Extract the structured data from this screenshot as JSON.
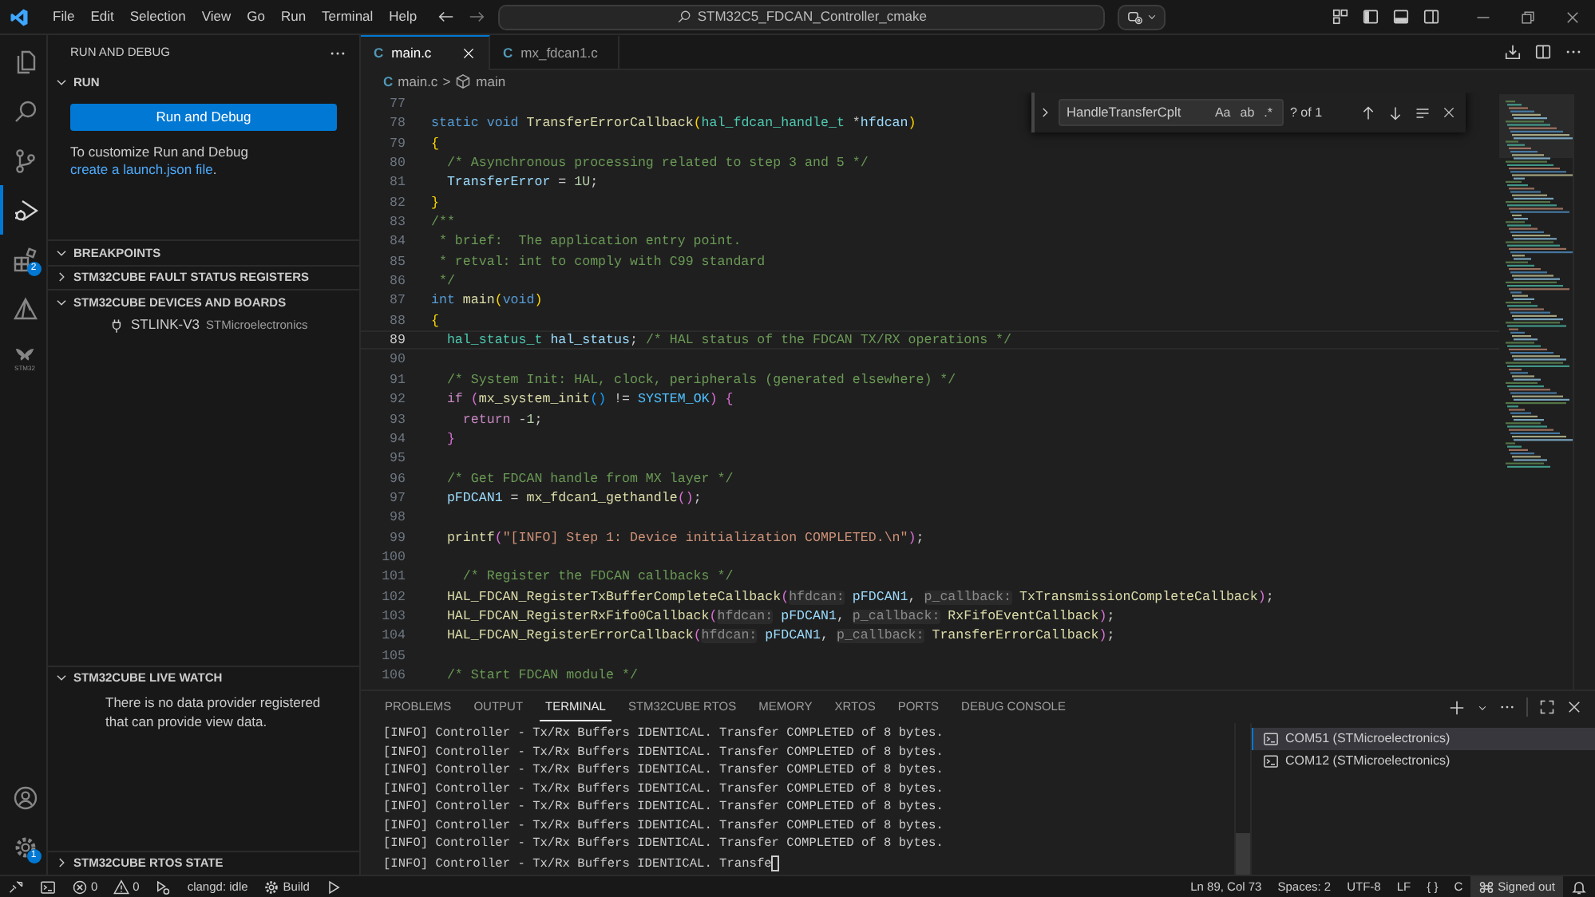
{
  "title_bar": {
    "menu": [
      "File",
      "Edit",
      "Selection",
      "View",
      "Go",
      "Run",
      "Terminal",
      "Help"
    ],
    "command_center": "STM32C5_FDCAN_Controller_cmake"
  },
  "activity_bar": {
    "items": [
      {
        "kind": "files",
        "selected": false
      },
      {
        "kind": "search",
        "selected": false
      },
      {
        "kind": "scm",
        "selected": false
      },
      {
        "kind": "debug",
        "selected": true
      },
      {
        "kind": "extensions",
        "selected": false,
        "badge": "2"
      },
      {
        "kind": "cube",
        "selected": false
      },
      {
        "kind": "stm32",
        "selected": false,
        "label": "STM32"
      }
    ],
    "bottom": [
      {
        "kind": "account"
      },
      {
        "kind": "settings",
        "badge": "1"
      }
    ]
  },
  "sidebar": {
    "title": "RUN AND DEBUG",
    "sections": [
      {
        "title": "RUN",
        "expanded": true,
        "kind": "run",
        "button": "Run and Debug",
        "text": "To customize Run and Debug ",
        "link": "create a launch.json file",
        "text_end": "."
      },
      {
        "title": "BREAKPOINTS",
        "expanded": true
      },
      {
        "title": "STM32CUBE FAULT STATUS REGISTERS",
        "expanded": false
      },
      {
        "title": "STM32CUBE DEVICES AND BOARDS",
        "expanded": true,
        "kind": "devices",
        "items": [
          {
            "name": "STLINK-V3",
            "detail": "STMicroelectronics"
          }
        ]
      },
      {
        "title": "STM32CUBE LIVE WATCH",
        "expanded": true,
        "kind": "message",
        "text": "There is no data provider registered that can provide view data."
      },
      {
        "title": "STM32CUBE RTOS STATE",
        "expanded": false
      }
    ]
  },
  "editor": {
    "tabs": [
      {
        "icon": "C",
        "label": "main.c",
        "selected": true
      },
      {
        "icon": "C",
        "label": "mx_fdcan1.c",
        "selected": false
      }
    ],
    "breadcrumbs": {
      "file_icon": "C",
      "file": "main.c",
      "separator": ">",
      "symbol": "main"
    },
    "find": {
      "value": "HandleTransferCplt",
      "options": [
        {
          "label": "Aa",
          "selected": false
        },
        {
          "label": "ab",
          "selected": false
        },
        {
          "label": ".*",
          "selected": false
        }
      ],
      "result": "? of 1"
    },
    "lines": [
      {
        "number": "77",
        "current": false
      },
      {
        "number": "78",
        "current": false,
        "tokens": [
          {
            "kind": "kw",
            "text": "static void "
          },
          {
            "kind": "fn",
            "text": "TransferErrorCallback"
          },
          {
            "kind": "br1",
            "text": "("
          },
          {
            "kind": "type",
            "text": "hal_fdcan_handle_t"
          },
          {
            "kind": "p",
            "text": " *"
          },
          {
            "kind": "var",
            "text": "hfdcan"
          },
          {
            "kind": "br1",
            "text": ")"
          }
        ]
      },
      {
        "number": "79",
        "current": false,
        "tokens": [
          {
            "kind": "br1",
            "text": "{"
          }
        ]
      },
      {
        "number": "80",
        "current": false,
        "tokens": [
          {
            "kind": "cm",
            "text": "  /* Asynchronous processing related to step 3 and 5 */"
          }
        ]
      },
      {
        "number": "81",
        "current": false,
        "tokens": [
          {
            "kind": "var",
            "text": "  TransferError"
          },
          {
            "kind": "p",
            "text": " = "
          },
          {
            "kind": "num",
            "text": "1U"
          },
          {
            "kind": "p",
            "text": ";"
          }
        ]
      },
      {
        "number": "82",
        "current": false,
        "tokens": [
          {
            "kind": "br1",
            "text": "}"
          }
        ]
      },
      {
        "number": "83",
        "current": false,
        "tokens": [
          {
            "kind": "cm",
            "text": "/**"
          }
        ]
      },
      {
        "number": "84",
        "current": false,
        "tokens": [
          {
            "kind": "cm",
            "text": " * brief:  The application entry point."
          }
        ]
      },
      {
        "number": "85",
        "current": false,
        "tokens": [
          {
            "kind": "cm",
            "text": " * retval: int to comply with C99 standard"
          }
        ]
      },
      {
        "number": "86",
        "current": false,
        "tokens": [
          {
            "kind": "cm",
            "text": " */"
          }
        ]
      },
      {
        "number": "87",
        "current": false,
        "tokens": [
          {
            "kind": "kw",
            "text": "int "
          },
          {
            "kind": "fn",
            "text": "main"
          },
          {
            "kind": "br1",
            "text": "("
          },
          {
            "kind": "kw",
            "text": "void"
          },
          {
            "kind": "br1",
            "text": ")"
          }
        ]
      },
      {
        "number": "88",
        "current": false,
        "tokens": [
          {
            "kind": "br1",
            "text": "{"
          }
        ]
      },
      {
        "number": "89",
        "current": true,
        "tokens": [
          {
            "kind": "type",
            "text": "  hal_status_t "
          },
          {
            "kind": "var",
            "text": "hal_status"
          },
          {
            "kind": "p",
            "text": "; "
          },
          {
            "kind": "cm",
            "text": "/* HAL status of the FDCAN TX/RX operations */"
          }
        ]
      },
      {
        "number": "90",
        "current": false
      },
      {
        "number": "91",
        "current": false,
        "tokens": [
          {
            "kind": "cm",
            "text": "  /* System Init: HAL, clock, peripherals (generated elsewhere) */"
          }
        ]
      },
      {
        "number": "92",
        "current": false,
        "tokens": [
          {
            "kind": "ctl",
            "text": "  if "
          },
          {
            "kind": "br2",
            "text": "("
          },
          {
            "kind": "fn",
            "text": "mx_system_init"
          },
          {
            "kind": "br3",
            "text": "()"
          },
          {
            "kind": "p",
            "text": " != "
          },
          {
            "kind": "macro",
            "text": "SYSTEM_OK"
          },
          {
            "kind": "br2",
            "text": ") {"
          }
        ]
      },
      {
        "number": "93",
        "current": false,
        "tokens": [
          {
            "kind": "ctl",
            "text": "    return"
          },
          {
            "kind": "p",
            "text": " -"
          },
          {
            "kind": "num",
            "text": "1"
          },
          {
            "kind": "p",
            "text": ";"
          }
        ]
      },
      {
        "number": "94",
        "current": false,
        "tokens": [
          {
            "kind": "br2",
            "text": "  }"
          }
        ]
      },
      {
        "number": "95",
        "current": false
      },
      {
        "number": "96",
        "current": false,
        "tokens": [
          {
            "kind": "cm",
            "text": "  /* Get FDCAN handle from MX layer */"
          }
        ]
      },
      {
        "number": "97",
        "current": false,
        "tokens": [
          {
            "kind": "var",
            "text": "  pFDCAN1"
          },
          {
            "kind": "p",
            "text": " = "
          },
          {
            "kind": "fn",
            "text": "mx_fdcan1_gethandle"
          },
          {
            "kind": "br2",
            "text": "()"
          },
          {
            "kind": "p",
            "text": ";"
          }
        ]
      },
      {
        "number": "98",
        "current": false
      },
      {
        "number": "99",
        "current": false,
        "tokens": [
          {
            "kind": "fn",
            "text": "  printf"
          },
          {
            "kind": "br2",
            "text": "("
          },
          {
            "kind": "str",
            "text": "\"[INFO] Step 1: Device initialization COMPLETED.\\n\""
          },
          {
            "kind": "br2",
            "text": ")"
          },
          {
            "kind": "p",
            "text": ";"
          }
        ]
      },
      {
        "number": "100",
        "current": false
      },
      {
        "number": "101",
        "current": false,
        "tokens": [
          {
            "kind": "cm",
            "text": "    /* Register the FDCAN callbacks */"
          }
        ]
      },
      {
        "number": "102",
        "current": false,
        "tokens": [
          {
            "kind": "fn",
            "text": "  HAL_FDCAN_RegisterTxBufferCompleteCallback"
          },
          {
            "kind": "br2",
            "text": "("
          },
          {
            "kind": "hint",
            "text": "hfdcan:"
          },
          {
            "kind": "var",
            "text": " pFDCAN1"
          },
          {
            "kind": "p",
            "text": ", "
          },
          {
            "kind": "hint",
            "text": "p_callback:"
          },
          {
            "kind": "fn",
            "text": " TxTransmissionCompleteCallback"
          },
          {
            "kind": "br2",
            "text": ")"
          },
          {
            "kind": "p",
            "text": ";"
          }
        ]
      },
      {
        "number": "103",
        "current": false,
        "tokens": [
          {
            "kind": "fn",
            "text": "  HAL_FDCAN_RegisterRxFifo0Callback"
          },
          {
            "kind": "br2",
            "text": "("
          },
          {
            "kind": "hint",
            "text": "hfdcan:"
          },
          {
            "kind": "var",
            "text": " pFDCAN1"
          },
          {
            "kind": "p",
            "text": ", "
          },
          {
            "kind": "hint",
            "text": "p_callback:"
          },
          {
            "kind": "fn",
            "text": " RxFifoEventCallback"
          },
          {
            "kind": "br2",
            "text": ")"
          },
          {
            "kind": "p",
            "text": ";"
          }
        ]
      },
      {
        "number": "104",
        "current": false,
        "tokens": [
          {
            "kind": "fn",
            "text": "  HAL_FDCAN_RegisterErrorCallback"
          },
          {
            "kind": "br2",
            "text": "("
          },
          {
            "kind": "hint",
            "text": "hfdcan:"
          },
          {
            "kind": "var",
            "text": " pFDCAN1"
          },
          {
            "kind": "p",
            "text": ", "
          },
          {
            "kind": "hint",
            "text": "p_callback:"
          },
          {
            "kind": "fn",
            "text": " TransferErrorCallback"
          },
          {
            "kind": "br2",
            "text": ")"
          },
          {
            "kind": "p",
            "text": ";"
          }
        ]
      },
      {
        "number": "105",
        "current": false
      },
      {
        "number": "106",
        "current": false,
        "tokens": [
          {
            "kind": "cm",
            "text": "  /* Start FDCAN module */"
          }
        ]
      }
    ]
  },
  "panel": {
    "tabs": [
      {
        "label": "PROBLEMS",
        "selected": false
      },
      {
        "label": "OUTPUT",
        "selected": false
      },
      {
        "label": "TERMINAL",
        "selected": true
      },
      {
        "label": "STM32CUBE RTOS",
        "selected": false
      },
      {
        "label": "MEMORY",
        "selected": false
      },
      {
        "label": "XRTOS",
        "selected": false
      },
      {
        "label": "PORTS",
        "selected": false
      },
      {
        "label": "DEBUG CONSOLE",
        "selected": false
      }
    ],
    "terminal_lines": [
      "[INFO] Controller - Tx/Rx Buffers IDENTICAL. Transfer COMPLETED of 8 bytes.",
      "[INFO] Controller - Tx/Rx Buffers IDENTICAL. Transfer COMPLETED of 8 bytes.",
      "[INFO] Controller - Tx/Rx Buffers IDENTICAL. Transfer COMPLETED of 8 bytes.",
      "[INFO] Controller - Tx/Rx Buffers IDENTICAL. Transfer COMPLETED of 8 bytes.",
      "[INFO] Controller - Tx/Rx Buffers IDENTICAL. Transfer COMPLETED of 8 bytes.",
      "[INFO] Controller - Tx/Rx Buffers IDENTICAL. Transfer COMPLETED of 8 bytes.",
      "[INFO] Controller - Tx/Rx Buffers IDENTICAL. Transfer COMPLETED of 8 bytes.",
      "[INFO] Controller - Tx/Rx Buffers IDENTICAL. Transfe"
    ],
    "cursor": true,
    "terminals": [
      {
        "label": "COM51 (STMicroelectronics)",
        "selected": true
      },
      {
        "label": "COM12 (STMicroelectronics)",
        "selected": false
      }
    ]
  },
  "status_bar": {
    "left": [
      {
        "kind": "remote"
      },
      {
        "kind": "terminal"
      },
      {
        "kind": "errors",
        "text": "0"
      },
      {
        "kind": "warnings",
        "text": "0"
      },
      {
        "kind": "debug"
      },
      {
        "kind": "text",
        "text": "clangd: idle"
      },
      {
        "kind": "build",
        "text": "Build"
      },
      {
        "kind": "run"
      }
    ],
    "right": [
      {
        "kind": "text",
        "text": "Ln 89, Col 73"
      },
      {
        "kind": "text",
        "text": "Spaces: 2"
      },
      {
        "kind": "text",
        "text": "UTF-8"
      },
      {
        "kind": "text",
        "text": "LF"
      },
      {
        "kind": "text",
        "text": "{ }"
      },
      {
        "kind": "text",
        "text": "C"
      },
      {
        "kind": "account",
        "text": "Signed out"
      },
      {
        "kind": "bell"
      }
    ]
  }
}
